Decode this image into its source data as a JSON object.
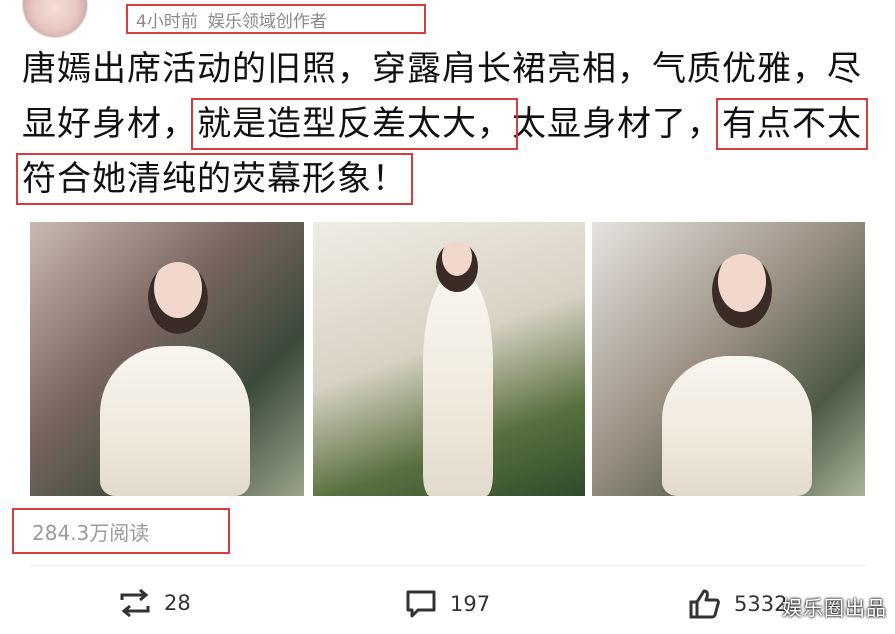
{
  "post": {
    "time": "4小时前",
    "author_tag": "娱乐领域创作者",
    "text_part1": "唐嫣出席活动的旧照，穿露肩长裙亮相，气质优雅，尽显好身材，",
    "text_highlight1": "就是造型反差太大，",
    "text_part2": "太显身材了，",
    "text_highlight2": "有点不太符合她清纯的荧幕形象！",
    "read_count": "284.3万阅读"
  },
  "photos": [
    {
      "alt": "photo-1"
    },
    {
      "alt": "photo-2"
    },
    {
      "alt": "photo-3"
    }
  ],
  "actions": {
    "repost_count": "28",
    "comment_count": "197",
    "like_count": "5332"
  },
  "watermark": "娱乐圈出品",
  "colors": {
    "highlight_border": "#d93a3a",
    "meta_text": "#8a8a8a"
  }
}
